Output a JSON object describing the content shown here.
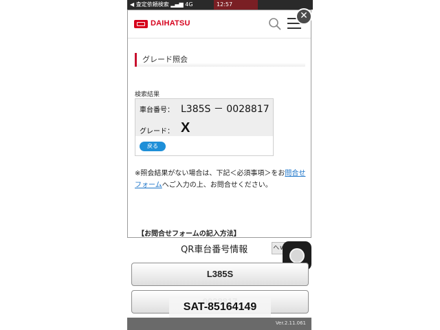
{
  "status_bar": {
    "back_app": "◀ 査定依頼検索",
    "network": "4G",
    "clock": "12:57"
  },
  "header": {
    "brand": "DAIHATSU",
    "search_icon": "search-icon",
    "menu_icon": "menu-icon"
  },
  "overlay_close": {
    "icon": "close-icon",
    "glyph": "✕"
  },
  "content": {
    "section_title": "グレード照会",
    "result_heading": "検索結果",
    "chassis_label": "車台番号：",
    "chassis_value": "L385S － 0028817",
    "grade_label": "グレード：",
    "grade_value": "X",
    "back_label": "戻る",
    "note_prefix": "※照会結果がない場合は、下記＜必須事項＞をお",
    "note_link": "問合せフォーム",
    "note_suffix": "へご入力の上、お問合せください。",
    "howto": "【お問合せフォームの記入方法】"
  },
  "qr_section": {
    "title": "QR車台番号情報",
    "toggle": "へ∨",
    "model_code": "L385S",
    "serial": "0028817"
  },
  "overlay_id": "SAT-85164149",
  "footer": {
    "version": "Ver.2.11.061"
  },
  "colors": {
    "brand_red": "#d6001c",
    "link_blue": "#1a73c8",
    "button_blue": "#1e8fd8"
  }
}
